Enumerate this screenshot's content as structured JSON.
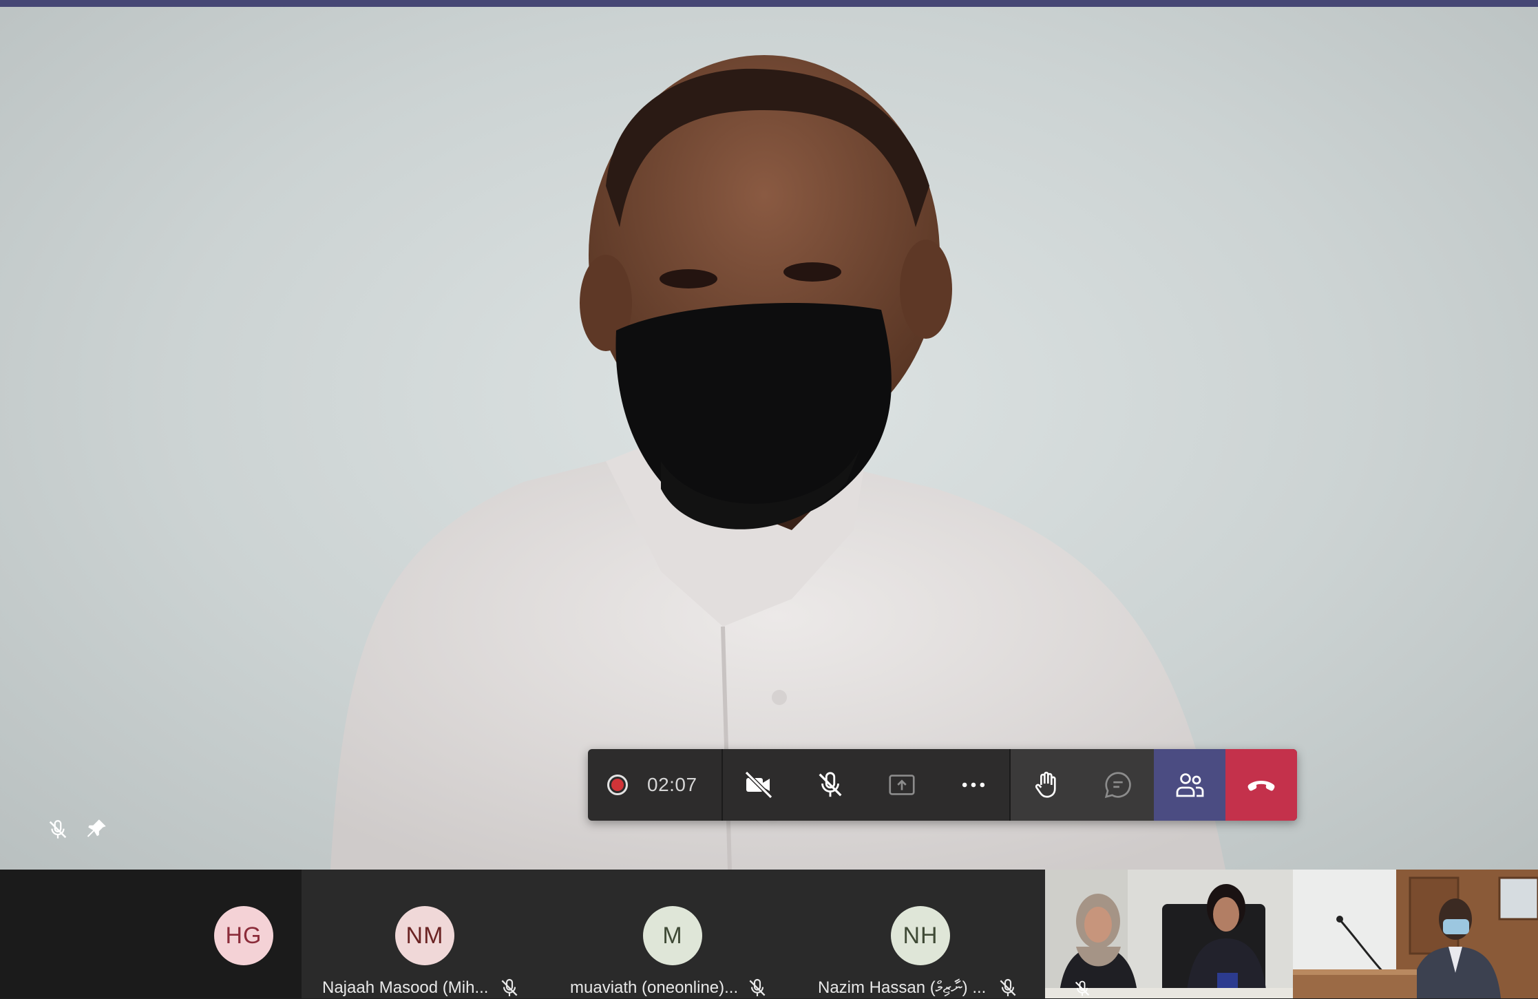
{
  "window": {
    "accent_color": "#464775"
  },
  "main_video": {
    "participant_icons": [
      "mic-off-icon",
      "pin-icon"
    ]
  },
  "call_controls": {
    "recording_icon": "record-icon",
    "elapsed_time": "02:07",
    "buttons": [
      {
        "name": "camera-off",
        "icon": "video-off-icon"
      },
      {
        "name": "mute",
        "icon": "mic-off-icon"
      },
      {
        "name": "share",
        "icon": "share-screen-icon"
      },
      {
        "name": "more",
        "icon": "more-icon"
      },
      {
        "name": "raise-hand",
        "icon": "hand-icon"
      },
      {
        "name": "chat",
        "icon": "chat-icon"
      },
      {
        "name": "participants",
        "icon": "people-icon"
      },
      {
        "name": "hang-up",
        "icon": "phone-hangup-icon"
      }
    ],
    "colors": {
      "bar": "#2d2c2c",
      "participants_active": "#4b4c82",
      "hangup": "#c4314b",
      "record": "#d13438"
    }
  },
  "participants": [
    {
      "initials": "HG",
      "name": "",
      "muted": false,
      "avatar_bg": "#f4d2d6",
      "avatar_fg": "#8b2c3a"
    },
    {
      "initials": "NM",
      "name": "Najaah Masood (Mih...",
      "muted": true,
      "avatar_bg": "#f0d8d8",
      "avatar_fg": "#6b2424"
    },
    {
      "initials": "M",
      "name": "muaviath (oneonline)...",
      "muted": true,
      "avatar_bg": "#dfe6d8",
      "avatar_fg": "#3f4a36"
    },
    {
      "initials": "NH",
      "name": "Nazim Hassan (ނާޒިމް) ...",
      "muted": true,
      "avatar_bg": "#dfe6d8",
      "avatar_fg": "#3f4a36"
    }
  ]
}
